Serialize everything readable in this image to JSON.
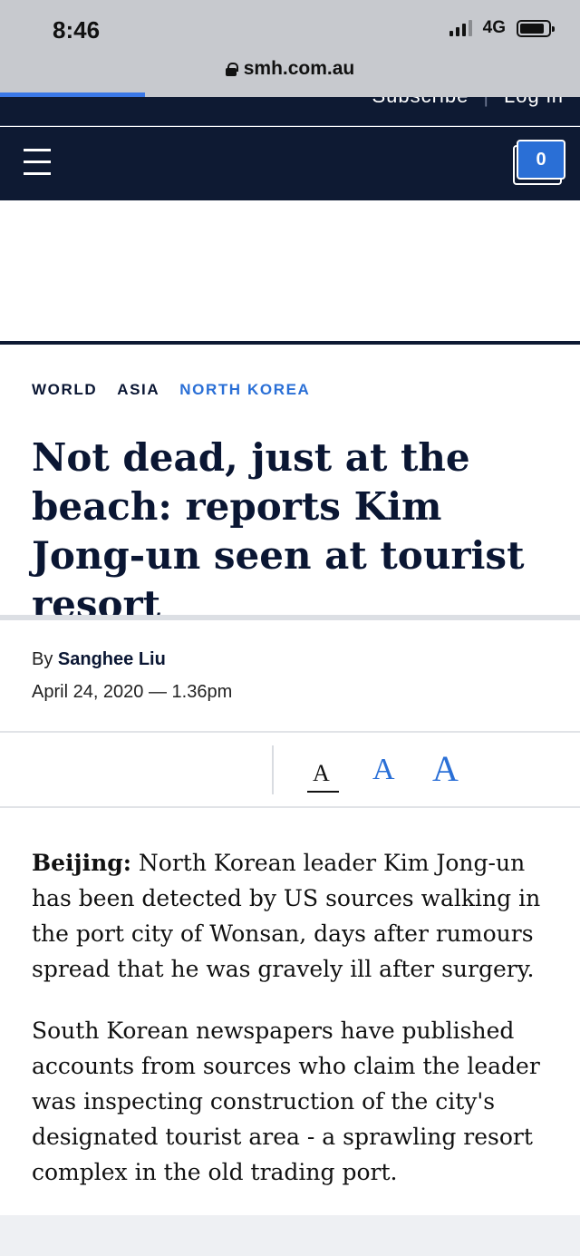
{
  "status_bar": {
    "time": "8:46",
    "network": "4G",
    "battery_level": 0.85
  },
  "browser": {
    "url": "smh.com.au",
    "load_progress": 0.25,
    "accent_color": "#3a78e8"
  },
  "site_header": {
    "subscribe_label": "Subscribe",
    "login_label": "Log in",
    "comment_count": "0",
    "brand_navy": "#0e1a33",
    "brand_blue": "#2a6fd6"
  },
  "breadcrumbs": [
    "WORLD",
    "ASIA",
    "NORTH KOREA"
  ],
  "article": {
    "headline": "Not dead, just at the beach: reports Kim Jong-un seen at tourist resort",
    "byline_prefix": "By",
    "author": "Sanghee Liu",
    "date": "April 24, 2020 — 1.36pm",
    "dateline": "Beijing:",
    "paragraph1": " North Korean leader Kim Jong-un has been detected by US sources walking in the port city of Wonsan, days after rumours spread that he was gravely ill after surgery.",
    "paragraph2": "South Korean newspapers have published accounts from sources who claim the leader was inspecting construction of the city's designated tourist area - a sprawling resort complex in the old trading port."
  },
  "font_size_controls": {
    "small_label": "A",
    "medium_label": "A",
    "large_label": "A",
    "selected": "small"
  }
}
